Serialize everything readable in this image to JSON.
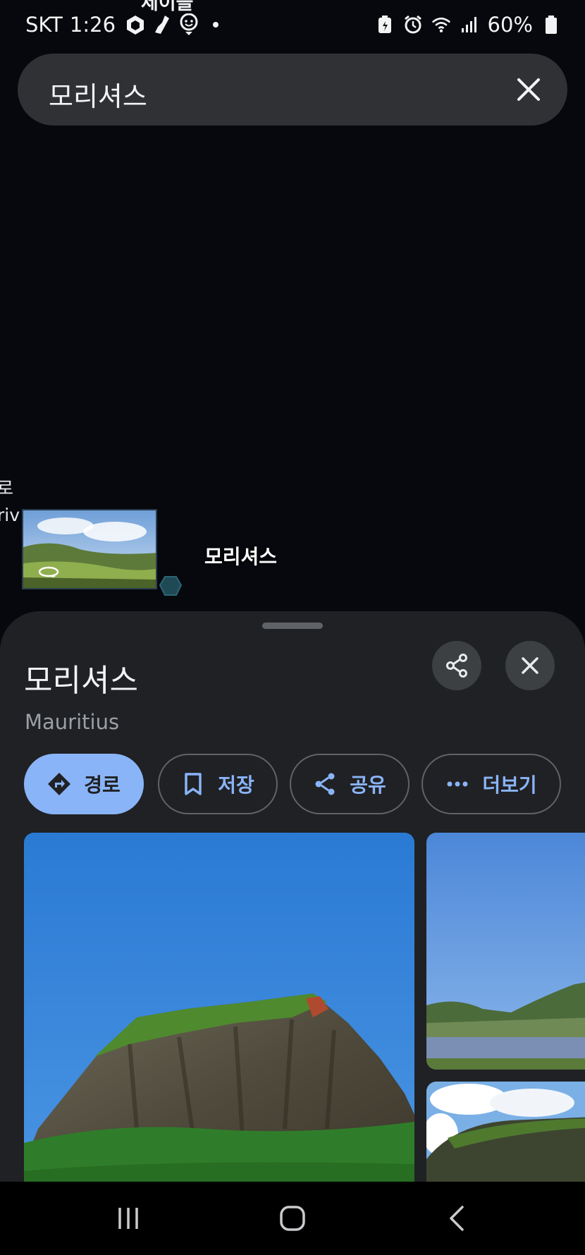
{
  "status_bar": {
    "carrier": "SKT",
    "time": "1:26",
    "battery_percent": "60%",
    "cut_off_label": "제이블"
  },
  "search": {
    "query": "모리셔스"
  },
  "map": {
    "edge_label_line1": "로",
    "edge_label_line2": "riv",
    "place_label": "모리셔스"
  },
  "sheet": {
    "title": "모리셔스",
    "subtitle": "Mauritius",
    "actions": {
      "directions": "경로",
      "save": "저장",
      "share": "공유",
      "more": "더보기"
    }
  },
  "colors": {
    "accent": "#8ab4f8",
    "sheet_bg": "#202124",
    "map_bg": "#06080d"
  }
}
